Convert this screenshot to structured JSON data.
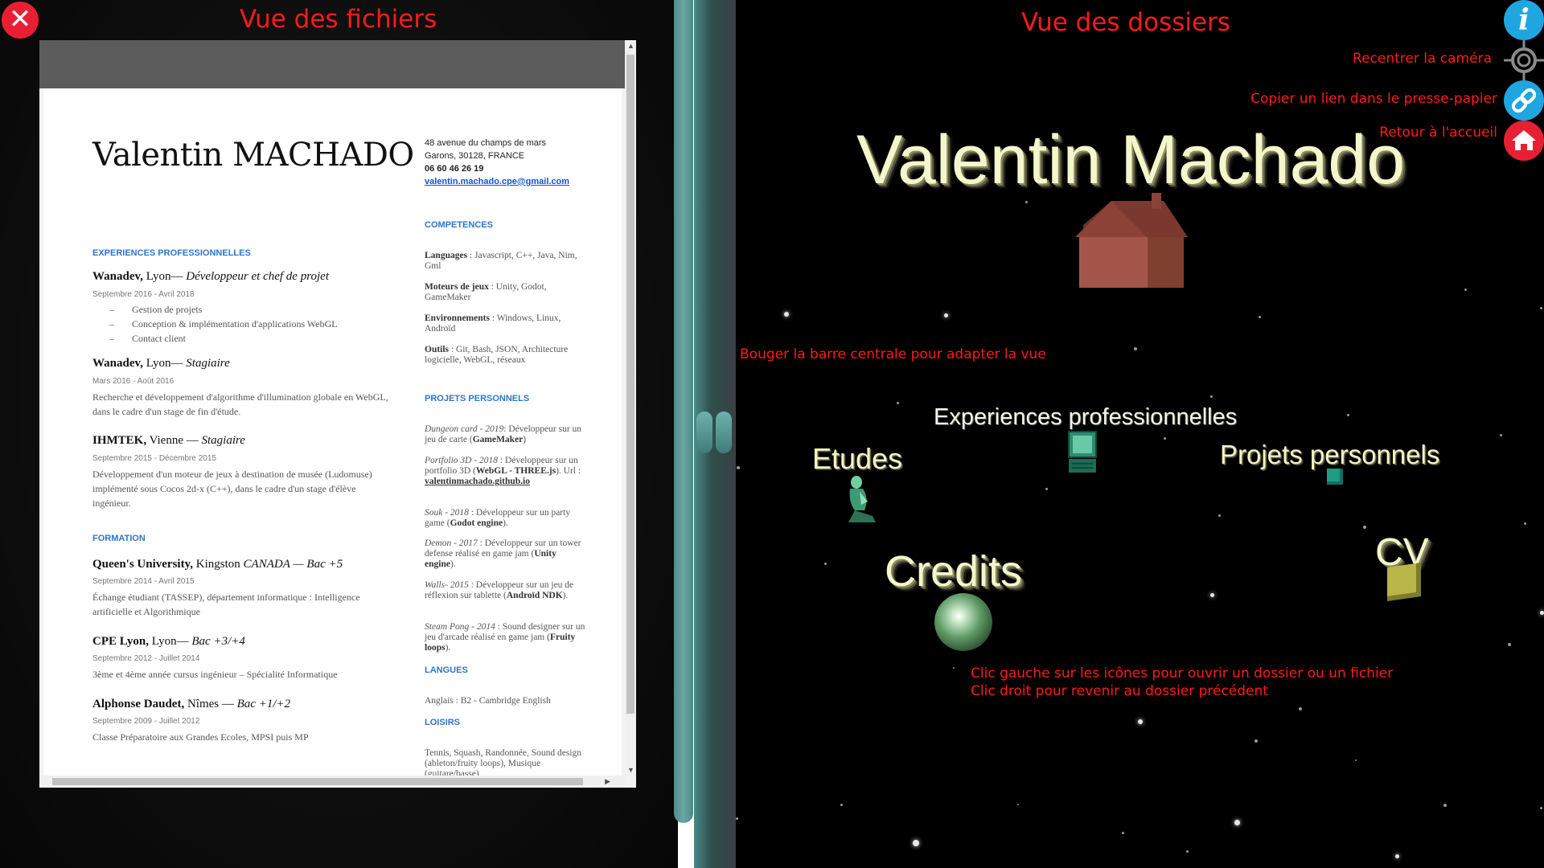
{
  "left_panel": {
    "close_icon": "close-icon",
    "title": "Vue des fichiers"
  },
  "cv": {
    "name": "Valentin MACHADO",
    "contact": {
      "address_line1": "48 avenue du champs de mars",
      "address_line2": "Garons, 30128, FRANCE",
      "phone": "06 60 46 26 19",
      "email": "valentin.machado.cpe@gmail.com"
    },
    "sections": {
      "experiences": "EXPERIENCES PROFESSIONNELLES",
      "formation": "FORMATION",
      "competences": "COMPETENCES",
      "projets": "PROJETS PERSONNELS",
      "langues": "LANGUES",
      "loisirs": "LOISIRS"
    },
    "jobs": [
      {
        "company": "Wanadev,",
        "place": " Lyon— ",
        "role": "Développeur et chef de projet",
        "date": "Septembre 2016 - Avril 2018"
      },
      {
        "company": "Wanadev,",
        "place": " Lyon— ",
        "role": "Stagiaire",
        "date": "Mars 2016 - Août 2016",
        "desc": "Recherche et développement d'algorithme d'illumination globale en WebGL, dans le cadre d'un stage de fin d'étude."
      },
      {
        "company": "IHMTEK,",
        "place": " Vienne — ",
        "role": "Stagiaire",
        "date": "Septembre 2015 - Décembre 2015",
        "desc": "Développement d'un moteur de jeux à destination de musée (Ludomuse) implémenté sous Cocos 2d-x (C++), dans le cadre d'un stage d'élève ingénieur."
      }
    ],
    "job1_bullets": [
      "Gestion de projets",
      "Conception & implémentation d'applications WebGL",
      "Contact client"
    ],
    "studies": [
      {
        "school": "Queen's University,",
        "place": " Kingston ",
        "country_degree": "CANADA — Bac +5",
        "date": "Septembre 2014 - Avril 2015",
        "desc": "Échange étudiant (TASSEP), département informatique : Intelligence artificielle et  Algorithmique"
      },
      {
        "school": "CPE Lyon,",
        "place": " Lyon— ",
        "country_degree": "Bac +3/+4",
        "date": "Septembre 2012 - Juillet 2014",
        "desc": "3ème et 4ème année cursus ingénieur – Spécialité Informatique"
      },
      {
        "school": "Alphonse Daudet,",
        "place": " Nîmes — ",
        "country_degree": "Bac +1/+2",
        "date": "Septembre 2009 - Juillet 2012",
        "desc": "Classe Préparatoire aux Grandes Ecoles, MPSI puis MP"
      }
    ],
    "skills": [
      {
        "k": "Languages",
        "v": " : Javascript, C++, Java, Nim, Gml"
      },
      {
        "k": "Moteurs de jeux",
        "v": " : Unity, Godot, GameMaker"
      },
      {
        "k": "Environnements",
        "v": " : Windows, Linux, Androïd"
      },
      {
        "k": "Outils",
        "v": " : Git, Bash, JSON, Architecture logicielle, WebGL, réseaux"
      }
    ],
    "projects": [
      {
        "name": "Dungeon card - 2019",
        "desc": ": Développeur sur un jeu de carte (",
        "tool": "GameMaker",
        "end": ")"
      },
      {
        "name": "Portfolio 3D - 2018",
        "desc": " : Développeur sur un portfolio 3D (",
        "tool": "WebGL - THREE.js",
        "end": "). Url : ",
        "url": "valentinmachado.github.io"
      },
      {
        "name": "Souk - 2018",
        "desc": " : Développeur sur un party game (",
        "tool": "Godot engine",
        "end": ")."
      },
      {
        "name": "Demon - 2017",
        "desc": " : Développeur sur un tower defense réalisé en game jam (",
        "tool": "Unity engine",
        "end": ")."
      },
      {
        "name": "Walls- 2015",
        "desc": " : Développeur sur un jeu de réflexion sur tablette (",
        "tool": "Androïd NDK",
        "end": ")."
      },
      {
        "name": "Steam Pong - 2014",
        "desc": " : Sound designer sur un jeu d'arcade réalisé en game jam (",
        "tool": "Fruity loops",
        "end": ")."
      }
    ],
    "langues": "Anglais : B2 - Cambridge English",
    "loisirs": "Tennis, Squash, Randonnée, Sound design (ableton/fruity loops), Musique (guitare/basse)"
  },
  "right_panel": {
    "title": "Vue des dossiers",
    "main_heading": "Valentin Machado",
    "menu": {
      "info_label": "i",
      "recenter_label": "Recentrer la caméra",
      "copy_link_label": "Copier un lien dans le presse-papier",
      "home_label": "Retour à l'accueil"
    },
    "hint_divider": "Bouger la barre centrale pour adapter la vue",
    "hint_click_left": "Clic gauche sur les icônes pour ouvrir un dossier ou un fichier",
    "hint_click_right": "Clic droit pour revenir au dossier précédent",
    "folders": {
      "experiences": "Experiences professionnelles",
      "etudes": "Etudes",
      "projets": "Projets personnels",
      "credits": "Credits",
      "cv": "CV"
    }
  },
  "colors": {
    "accent_red": "#ff1a1a",
    "close_button": "#e81f33",
    "info_button": "#1fa6e0",
    "divider": "#5e9d99",
    "cv_section": "#2f75c9"
  }
}
